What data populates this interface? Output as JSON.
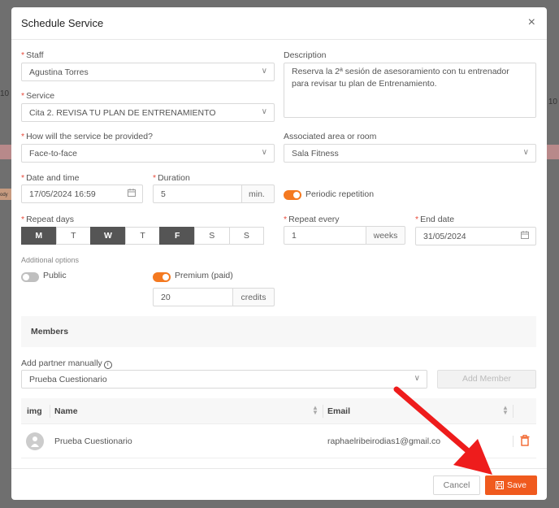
{
  "background": {
    "left_text": "10",
    "left_text2": "ody",
    "right_text": "10"
  },
  "modal": {
    "title": "Schedule Service",
    "close": "×"
  },
  "form": {
    "staff": {
      "label": "Staff",
      "value": "Agustina Torres"
    },
    "description": {
      "label": "Description",
      "value": "Reserva la 2ª sesión de asesoramiento con tu entrenador para revisar tu plan de Entrenamiento."
    },
    "service": {
      "label": "Service",
      "value": "Cita 2. REVISA TU PLAN DE ENTRENAMIENTO"
    },
    "provided": {
      "label": "How will the service be provided?",
      "value": "Face-to-face"
    },
    "area": {
      "label": "Associated area or room",
      "value": "Sala Fitness"
    },
    "datetime": {
      "label": "Date and time",
      "value": "17/05/2024 16:59"
    },
    "duration": {
      "label": "Duration",
      "value": "5",
      "unit": "min."
    },
    "periodic": {
      "label": "Periodic repetition",
      "on": true
    },
    "repeat_days": {
      "label": "Repeat days",
      "days": [
        {
          "label": "M",
          "selected": true
        },
        {
          "label": "T",
          "selected": false
        },
        {
          "label": "W",
          "selected": true
        },
        {
          "label": "T",
          "selected": false
        },
        {
          "label": "F",
          "selected": true
        },
        {
          "label": "S",
          "selected": false
        },
        {
          "label": "S",
          "selected": false
        }
      ]
    },
    "repeat_every": {
      "label": "Repeat every",
      "value": "1",
      "unit": "weeks"
    },
    "end_date": {
      "label": "End date",
      "value": "31/05/2024"
    },
    "additional_options": "Additional options",
    "public": {
      "label": "Public",
      "on": false
    },
    "premium": {
      "label": "Premium (paid)",
      "on": true,
      "value": "20",
      "unit": "credits"
    }
  },
  "members": {
    "title": "Members",
    "add_label": "Add partner manually",
    "add_value": "Prueba Cuestionario",
    "add_button": "Add Member",
    "columns": {
      "img": "img",
      "name": "Name",
      "email": "Email"
    },
    "rows": [
      {
        "name": "Prueba Cuestionario",
        "email": "raphaelribeirodias1@gmail.co"
      }
    ]
  },
  "footer": {
    "cancel": "Cancel",
    "save": "Save"
  },
  "colors": {
    "accent": "#f05a1e",
    "toggle_on": "#f47920",
    "arrow": "#ee1c1c"
  }
}
